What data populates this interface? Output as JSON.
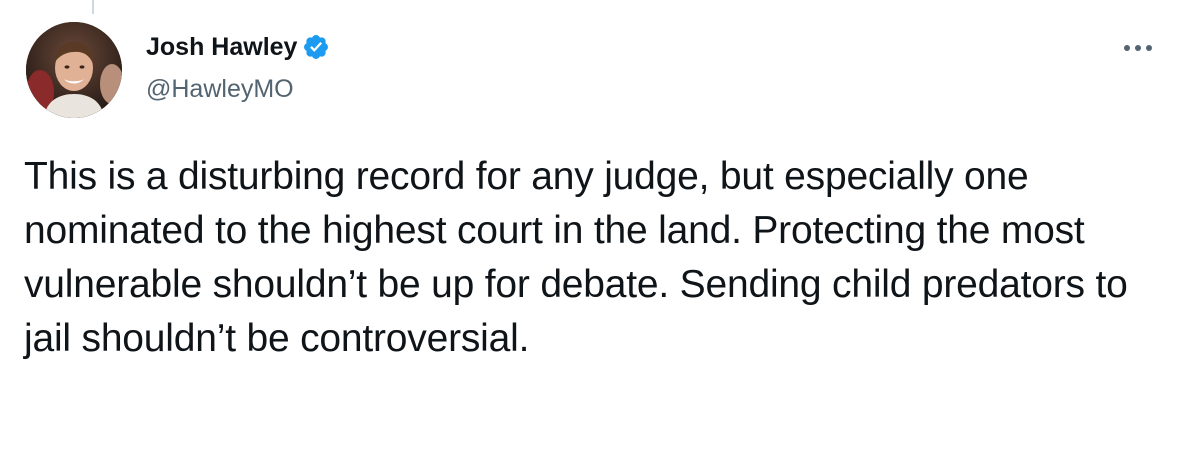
{
  "author": {
    "display_name": "Josh Hawley",
    "handle": "@HawleyMO",
    "verified": true,
    "avatar_icon": "profile-photo"
  },
  "more_icon": "ellipsis-icon",
  "tweet": {
    "text": "This is a disturbing record for any judge, but especially one nominated to the highest court in the land. Protecting the most vulnerable shouldn’t be up for debate. Sending child predators to jail shouldn’t be controversial."
  },
  "colors": {
    "verified_blue": "#1d9bf0",
    "text_primary": "#0f1419",
    "text_secondary": "#536471",
    "thread_line": "#cfd9de"
  }
}
